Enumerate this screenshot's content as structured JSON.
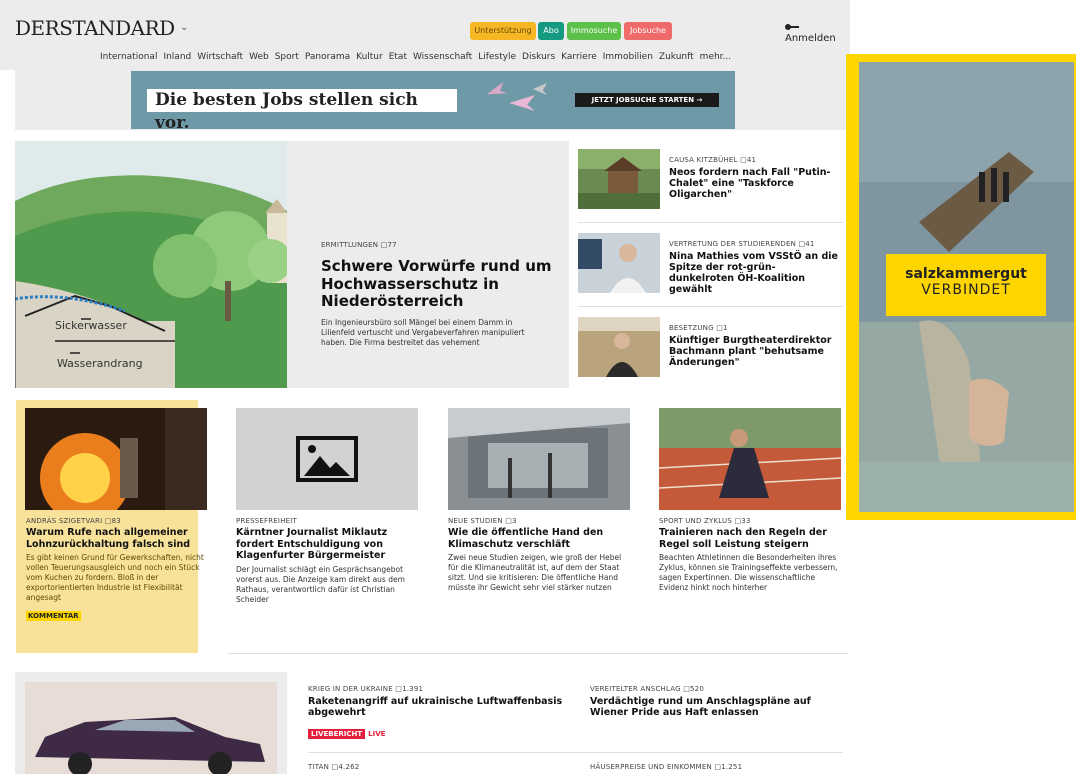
{
  "header": {
    "logo": "DERSTANDARD",
    "buttons": [
      {
        "label": "Unterstützung",
        "color": "#f5b824"
      },
      {
        "label": "Abo",
        "color": "#159a82"
      },
      {
        "label": "Immosuche",
        "color": "#5cc04a"
      },
      {
        "label": "Jobsuche",
        "color": "#ef6a6a"
      }
    ],
    "login": "Anmelden",
    "nav": [
      "International",
      "Inland",
      "Wirtschaft",
      "Web",
      "Sport",
      "Panorama",
      "Kultur",
      "Etat",
      "Wissenschaft",
      "Lifestyle",
      "Diskurs",
      "Karriere",
      "Immobilien",
      "Zukunft",
      "mehr..."
    ]
  },
  "banner": {
    "headline": "Die besten Jobs stellen sich vor.",
    "cta": "JETZT JOBSUCHE STARTEN →"
  },
  "lead": {
    "image_labels": [
      "Sickerwasser",
      "Wasserandrang"
    ],
    "kicker": "ERMITTLUNGEN",
    "comments": "77",
    "title": "Schwere Vorwürfe rund um Hochwasserschutz in Nieder­österreich",
    "teaser": "Ein Ingenieursbüro soll Mängel bei einem Damm in Lilienfeld vertuscht und Vergabeverfahren manipuliert haben. Die Firma bestreitet das vehement"
  },
  "side_stories": [
    {
      "kicker": "CAUSA KITZBÜHEL",
      "comments": "41",
      "title": "Neos fordern nach Fall \"Putin-Chalet\" eine \"Taskforce Oligarchen\""
    },
    {
      "kicker": "VERTRETUNG DER STUDIERENDEN",
      "comments": "41",
      "title": "Nina Mathies vom VSStÖ an die Spitze der rot-grün-dunkelroten ÖH-Koalition gewählt"
    },
    {
      "kicker": "BESETZUNG",
      "comments": "1",
      "title": "Künftiger Burgtheaterdirektor Bachmann plant \"behutsame Änderungen\""
    }
  ],
  "ad": {
    "line1": "salzkammergut",
    "line2": "VERBINDET"
  },
  "cards": [
    {
      "kicker": "ANDRÁS SZIGETVARI",
      "comments": "83",
      "title": "Warum Rufe nach allgemeiner Lohnzurückhaltung falsch sind",
      "teaser": "Es gibt keinen Grund für Gewerkschaf­ten, nicht vollen Teuerungsausgleich und noch ein Stück vom Kuchen zu fordern. Bloß in der exportorientierten Industrie ist Flexibilität angesagt",
      "tag": "KOMMENTAR"
    },
    {
      "kicker": "PRESSEFREIHEIT",
      "comments": "",
      "title": "Kärntner Journalist Miklautz fordert Entschuldigung von Klagenfurter Bürgermeister",
      "teaser": "Der Journalist schlägt ein Gesprächsan­gebot vorerst aus. Die Anzeige kam direkt aus dem Rathaus, verantwortlich dafür ist Christian Scheider"
    },
    {
      "kicker": "NEUE STUDIEN",
      "comments": "3",
      "title": "Wie die öffentliche Hand den Klimaschutz verschläft",
      "teaser": "Zwei neue Studien zeigen, wie groß der Hebel für die Klimaneutralität ist, auf dem der Staat sitzt. Und sie kritisieren: Die öffentliche Hand müsste ihr Gewicht sehr viel stärker nutzen"
    },
    {
      "kicker": "SPORT UND ZYKLUS",
      "comments": "33",
      "title": "Trainieren nach den Regeln der Regel soll Leistung steigern",
      "teaser": "Beachten Athletinnen die Besonderheiten ihres Zyklus, können sie Trainingseffekte verbessern, sagen Expertinnen. Die wissenschaftliche Evidenz hinkt noch hinterher"
    }
  ],
  "bottom": [
    {
      "kicker": "KRIEG IN DER UKRAINE",
      "comments": "1.391",
      "title": "Raketenangriff auf ukrainische Luftwaffenbasis abgewehrt",
      "badge": "LIVEBERICHT",
      "live": "LIVE"
    },
    {
      "kicker": "VEREITELTER ANSCHLAG",
      "comments": "520",
      "title": "Verdächtige rund um Anschlagspläne auf Wiener Pride aus Haft enlassen"
    },
    {
      "kicker": "TITAN",
      "comments": "4.262"
    },
    {
      "kicker": "HÄUSERPREISE UND EINKOMMEN",
      "comments": "1.251"
    }
  ]
}
